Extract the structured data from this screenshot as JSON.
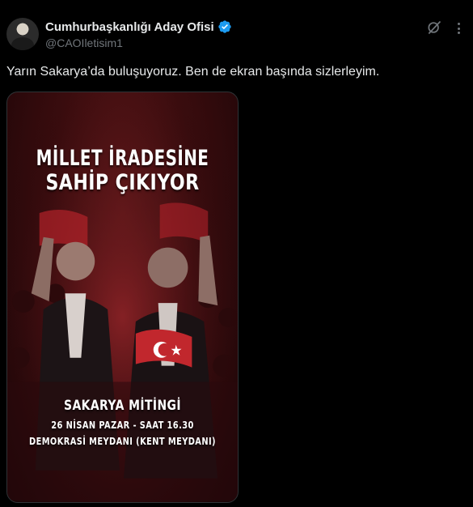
{
  "author": {
    "display_name": "Cumhurbaşkanlığı Aday Ofisi",
    "handle": "@CAOIletisim1",
    "verified_color": "#1d9bf0"
  },
  "header_icons": [
    "grok-icon",
    "more-options-icon"
  ],
  "tweet": {
    "text": "Yarın Sakarya’da buluşuyoruz. Ben de ekran başında sizlerleyim."
  },
  "poster": {
    "headline_line1": "MİLLET İRADESİNE",
    "headline_line2": "SAHİP ÇIKIYOR",
    "rally_title": "SAKARYA MİTİNGİ",
    "rally_date": "26 NİSAN PAZAR - SAAT 16.30",
    "rally_place": "DEMOKRASİ MEYDANI (KENT MEYDANI)",
    "theme_color": "#6a1a1c"
  }
}
